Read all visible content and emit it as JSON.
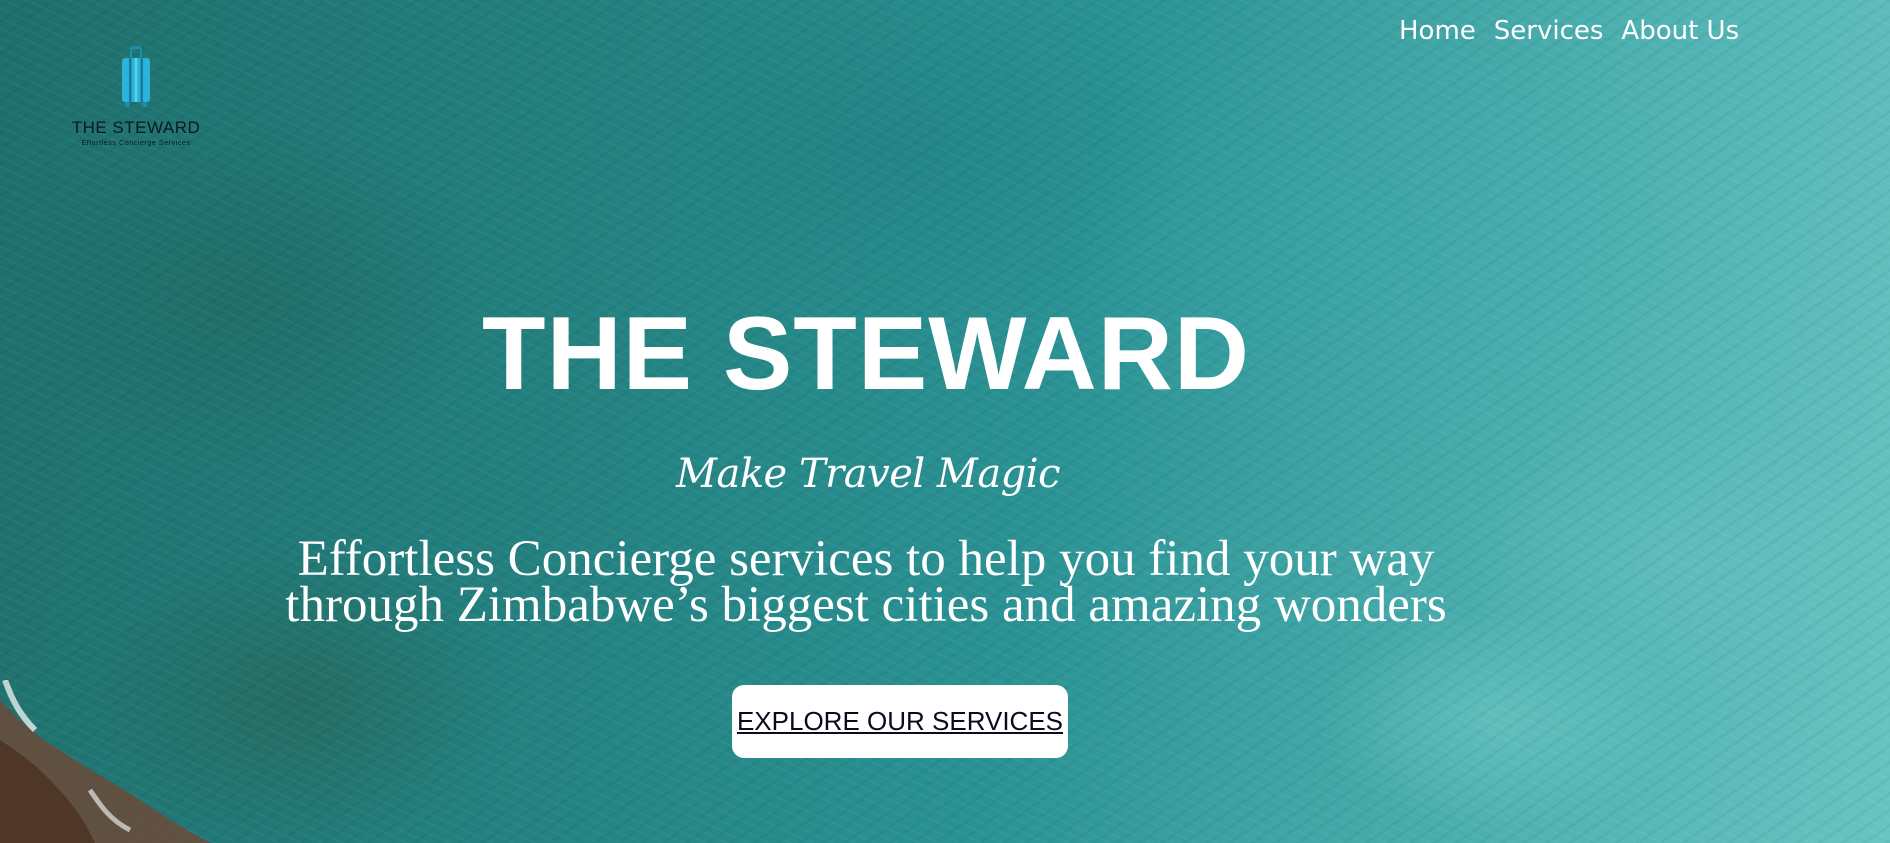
{
  "nav": {
    "links": [
      "Home",
      "Services",
      "About Us"
    ]
  },
  "logo": {
    "title": "THE STEWARD",
    "tagline": "Effortless Concierge Services",
    "icon": "suitcase-icon",
    "icon_color": "#2bb3d9"
  },
  "hero": {
    "title": "THE STEWARD",
    "tagline": "Make Travel Magic",
    "description_lines": [
      "Effortless Concierge services to help you find your way",
      "through Zimbabwe’s biggest cities and amazing wonders"
    ],
    "cta_label": "EXPLORE OUR SERVICES"
  },
  "colors": {
    "text": "#ffffff",
    "button_bg": "#ffffff",
    "button_text": "#0a0a1e",
    "logo_text": "#0b1a1d",
    "background": "#2a9294"
  }
}
